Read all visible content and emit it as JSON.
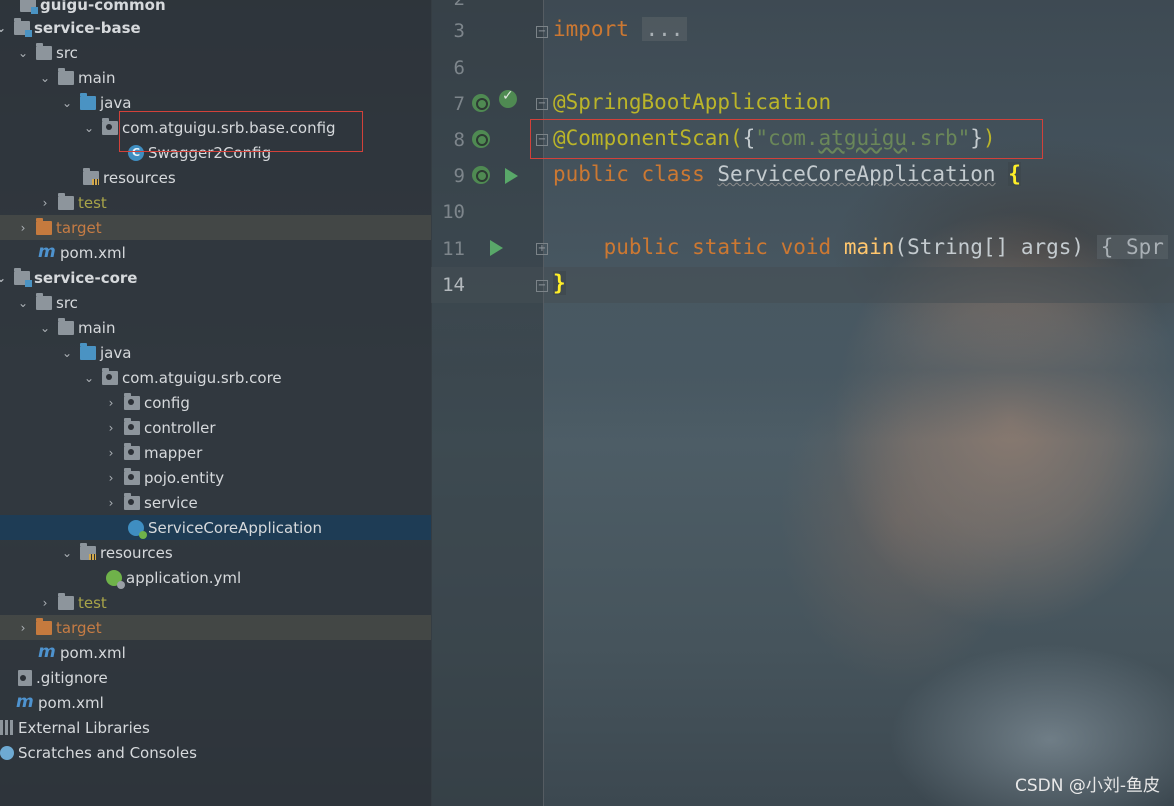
{
  "project_tree": {
    "rows": [
      {
        "label": "guigu-common"
      },
      {
        "label": "service-base"
      },
      {
        "label": "src"
      },
      {
        "label": "main"
      },
      {
        "label": "java"
      },
      {
        "label": "com.atguigu.srb.base.config"
      },
      {
        "label": "Swagger2Config"
      },
      {
        "label": "resources"
      },
      {
        "label": "test"
      },
      {
        "label": "target"
      },
      {
        "label": "pom.xml"
      },
      {
        "label": "service-core"
      },
      {
        "label": "src"
      },
      {
        "label": "main"
      },
      {
        "label": "java"
      },
      {
        "label": "com.atguigu.srb.core"
      },
      {
        "label": "config"
      },
      {
        "label": "controller"
      },
      {
        "label": "mapper"
      },
      {
        "label": "pojo.entity"
      },
      {
        "label": "service"
      },
      {
        "label": "ServiceCoreApplication"
      },
      {
        "label": "resources"
      },
      {
        "label": "application.yml"
      },
      {
        "label": "test"
      },
      {
        "label": "target"
      },
      {
        "label": "pom.xml"
      },
      {
        "label": ".gitignore"
      },
      {
        "label": "pom.xml"
      },
      {
        "label": "External Libraries"
      },
      {
        "label": "Scratches and Consoles"
      }
    ],
    "selected": "ServiceCoreApplication"
  },
  "editor": {
    "line_numbers": [
      "2",
      "3",
      "6",
      "7",
      "8",
      "9",
      "10",
      "11",
      "14"
    ],
    "current_line": "14",
    "tokens": {
      "import_kw": "import",
      "import_fold": "...",
      "ann1": "@SpringBootApplication",
      "ann2_name": "@ComponentScan(",
      "ann2_brace_open": "{",
      "ann2_str_q1": "\"com.",
      "ann2_str_mid": "atguigu",
      "ann2_str_q2": ".srb\"",
      "ann2_brace_close": "}",
      "ann2_paren": ")",
      "public_kw": "public",
      "class_kw": "class",
      "class_name": "ServiceCoreApplication",
      "class_brace": "{",
      "main_public": "public",
      "main_static": "static",
      "main_void": "void",
      "main_name": "main",
      "main_args": "(String[] args)",
      "main_fold": "{ Spr",
      "end_brace": "}"
    }
  },
  "watermark": "CSDN @小刘-鱼皮",
  "colors": {
    "keyword": "#cc7832",
    "annotation": "#bbb529",
    "string": "#6a8759",
    "method": "#ffc66d",
    "selection": "#1e3c55",
    "highlight_box": "#d2413a"
  }
}
